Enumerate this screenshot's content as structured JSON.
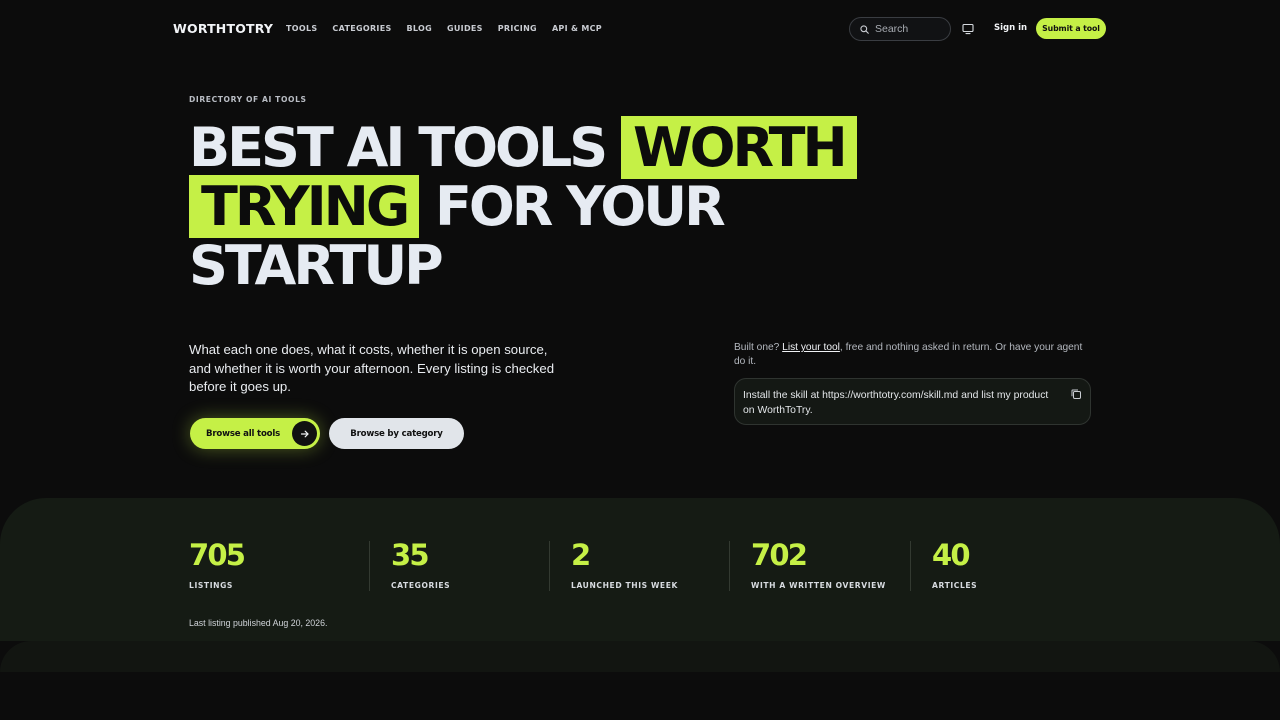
{
  "brand": {
    "logo": "WORTHTOTRY",
    "accent": "#c5f046",
    "background": "#0c0c0c"
  },
  "nav": {
    "links": [
      "TOOLS",
      "CATEGORIES",
      "BLOG",
      "GUIDES",
      "PRICING",
      "API & MCP"
    ],
    "search_placeholder": "Search",
    "sign_in": "Sign in",
    "submit": "Submit a tool"
  },
  "hero": {
    "eyebrow": "DIRECTORY OF AI TOOLS",
    "headline_part1": "BEST AI TOOLS ",
    "headline_highlight1": "WORTH",
    "headline_highlight2": "TRYING",
    "headline_part2": " FOR YOUR STARTUP",
    "lede": "What each one does, what it costs, whether it is open source, and whether it is worth your afternoon. Every listing is checked before it goes up.",
    "primary_button": "Browse all tools",
    "secondary_button": "Browse by category",
    "side_note_prefix": "Built one? ",
    "side_note_link": "List your tool",
    "side_note_suffix": ", free and nothing asked in return. Or have your agent do it.",
    "agent_prompt": "Install the skill at https://worthtotry.com/skill.md and list my product on WorthToTry."
  },
  "stats": {
    "items": [
      {
        "value": "705",
        "label": "LISTINGS"
      },
      {
        "value": "35",
        "label": "CATEGORIES"
      },
      {
        "value": "2",
        "label": "LAUNCHED THIS WEEK"
      },
      {
        "value": "702",
        "label": "WITH A WRITTEN OVERVIEW"
      },
      {
        "value": "40",
        "label": "ARTICLES"
      }
    ],
    "last_published": "Last listing published Aug 20, 2026."
  }
}
